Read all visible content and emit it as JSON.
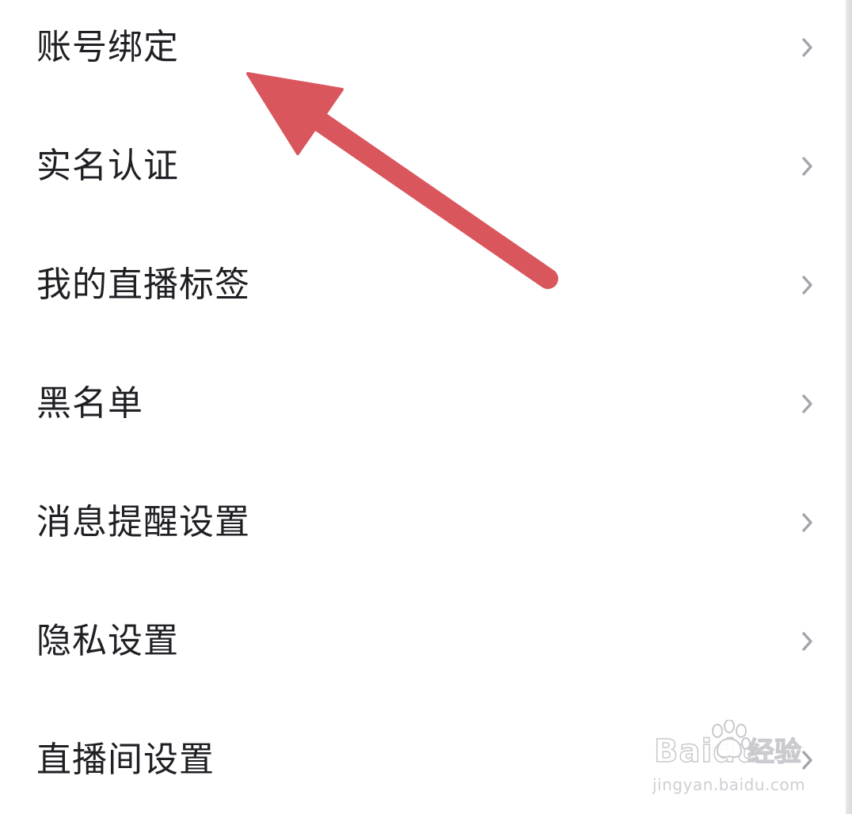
{
  "settings": {
    "items": [
      {
        "label": "账号绑定",
        "icon": "chevron-right-icon"
      },
      {
        "label": "实名认证",
        "icon": "chevron-right-icon"
      },
      {
        "label": "我的直播标签",
        "icon": "chevron-right-icon"
      },
      {
        "label": "黑名单",
        "icon": "chevron-right-icon"
      },
      {
        "label": "消息提醒设置",
        "icon": "chevron-right-icon"
      },
      {
        "label": "隐私设置",
        "icon": "chevron-right-icon"
      },
      {
        "label": "直播间设置",
        "icon": "chevron-right-icon"
      }
    ]
  },
  "annotation": {
    "arrow_color": "#d9565d",
    "points_to": "账号绑定"
  },
  "watermark": {
    "logo_text": "Baidu",
    "brand_text": "经验",
    "url_text": "jingyan.baidu.com"
  },
  "colors": {
    "background": "#ffffff",
    "text": "#1f1f24",
    "chevron": "#a4a4ac"
  }
}
